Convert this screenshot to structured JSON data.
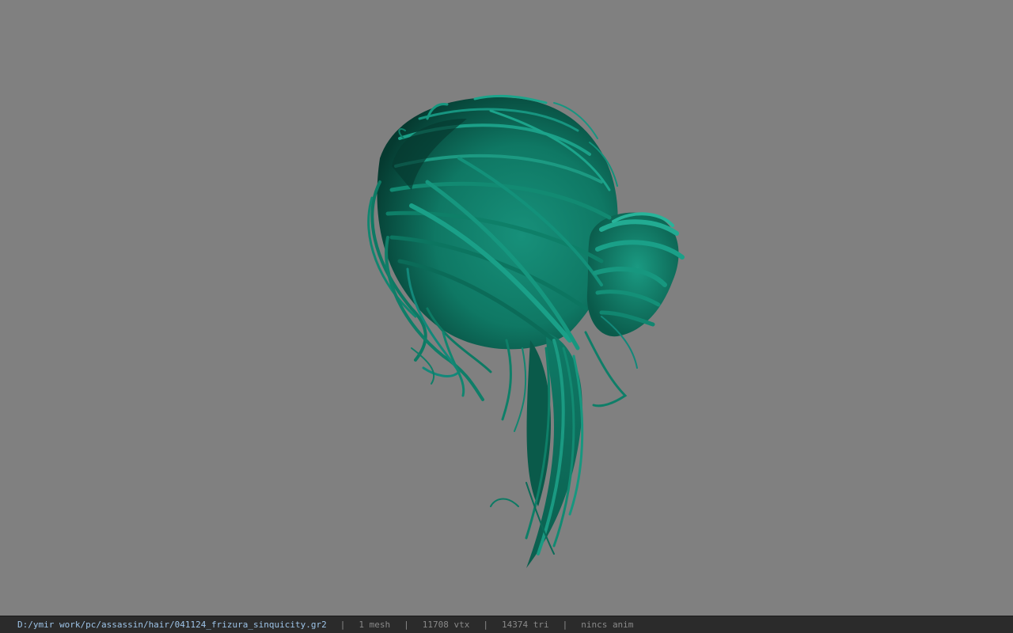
{
  "viewer": {
    "background_color": "#808080",
    "model_color": "#0f7a66",
    "model_icon": "hair-mesh-icon"
  },
  "status_bar": {
    "file_path": "D:/ymir work/pc/assassin/hair/041124_frizura_sinquicity.gr2",
    "separator": "|",
    "mesh_count": "1 mesh",
    "vertex_count": "11708 vtx",
    "triangle_count": "14374 tri",
    "anim_status": "nincs anim"
  }
}
